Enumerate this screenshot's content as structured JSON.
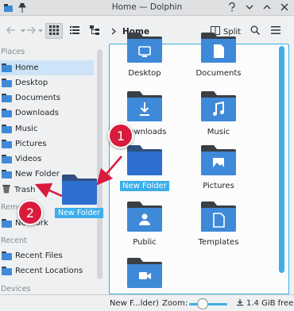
{
  "window": {
    "title": "Home — Dolphin"
  },
  "titlebar_icons": [
    "app-icon",
    "pin-icon",
    "help-icon",
    "minimize-icon",
    "maximize-icon",
    "close-icon"
  ],
  "toolbar": {
    "breadcrumb": "Home",
    "split_label": "Split"
  },
  "sidebar": {
    "sections": {
      "places": "Places",
      "remote": "Remote",
      "recent": "Recent",
      "devices": "Devices"
    },
    "places": [
      {
        "label": "Home",
        "selected": true
      },
      {
        "label": "Desktop"
      },
      {
        "label": "Documents"
      },
      {
        "label": "Downloads"
      },
      {
        "label": "Music"
      },
      {
        "label": "Pictures"
      },
      {
        "label": "Videos"
      },
      {
        "label": "New Folder"
      },
      {
        "label": "Trash"
      }
    ],
    "remote": [
      {
        "label": "Network"
      }
    ],
    "recent": [
      {
        "label": "Recent Files"
      },
      {
        "label": "Recent Locations"
      }
    ],
    "devices": [
      {
        "label": "/"
      }
    ]
  },
  "files": [
    {
      "label": "Desktop",
      "emblem": "desktop"
    },
    {
      "label": "Documents",
      "emblem": "document"
    },
    {
      "label": "Downloads",
      "emblem": "download"
    },
    {
      "label": "Music",
      "emblem": "music"
    },
    {
      "label": "New Folder",
      "emblem": "none",
      "selected": true
    },
    {
      "label": "Pictures",
      "emblem": "picture"
    },
    {
      "label": "Public",
      "emblem": "user"
    },
    {
      "label": "Templates",
      "emblem": "template"
    },
    {
      "label": "",
      "emblem": "video"
    }
  ],
  "drag": {
    "label": "New Folder"
  },
  "annotations": {
    "step1": "1",
    "step2": "2"
  },
  "statusbar": {
    "selection": "New F...lder)",
    "zoom_label": "Zoom:",
    "free_space": "1.4 GiB free"
  },
  "colors": {
    "accent": "#3daee9",
    "folder": "#3f89d9",
    "folder_selected": "#2c6fcf",
    "folder_tab": "#3a3f44",
    "annotation": "#d81b3c"
  }
}
